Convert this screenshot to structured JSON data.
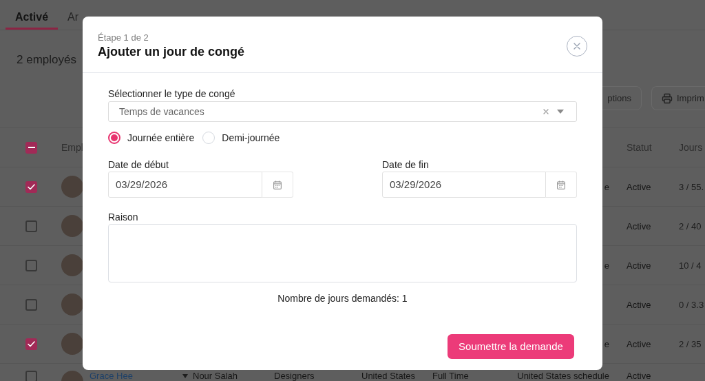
{
  "page": {
    "tabs": [
      {
        "label": "Activé",
        "selected": true
      },
      {
        "label": "Ar",
        "selected": false
      }
    ],
    "summary": "2 employés",
    "toolbar": [
      {
        "kind": "options",
        "label": "ptions"
      },
      {
        "kind": "print",
        "label": "Imprim"
      }
    ],
    "table": {
      "select_all": {
        "indeterminate": true
      },
      "headers": {
        "employee": "Empl",
        "status": "Statut",
        "days": "Jours"
      },
      "rows": [
        {
          "checked": true,
          "schedule": "e",
          "status": "Active",
          "days": "3 / 55."
        },
        {
          "checked": false,
          "status": "Active",
          "days": "2 / 40"
        },
        {
          "checked": false,
          "schedule": "e",
          "status": "Active",
          "days": "10 / 4"
        },
        {
          "checked": false,
          "status": "Active",
          "days": "0 / 3.3"
        },
        {
          "checked": true,
          "schedule": "e",
          "status": "Active",
          "days": "2 / 35"
        },
        {
          "checked": false,
          "employee": "Grace Hee",
          "manager": "Nour Salah",
          "team": "Designers",
          "country": "United States",
          "type": "Full Time",
          "schedule": "United States schedule",
          "status": "Active"
        }
      ]
    }
  },
  "modal": {
    "step": "Étape 1 de 2",
    "title": "Ajouter un jour de congé",
    "leave_type": {
      "label": "Sélectionner le type de congé",
      "value": "Temps de vacances"
    },
    "duration_options": [
      {
        "label": "Journée entière",
        "selected": true
      },
      {
        "label": "Demi-journée",
        "selected": false
      }
    ],
    "start_date": {
      "label": "Date de début",
      "value": "03/29/2026"
    },
    "end_date": {
      "label": "Date de fin",
      "value": "03/29/2026"
    },
    "reason": {
      "label": "Raison"
    },
    "days_requested": "Nombre de jours demandés: 1",
    "submit_button": "Soumettre la demande"
  }
}
